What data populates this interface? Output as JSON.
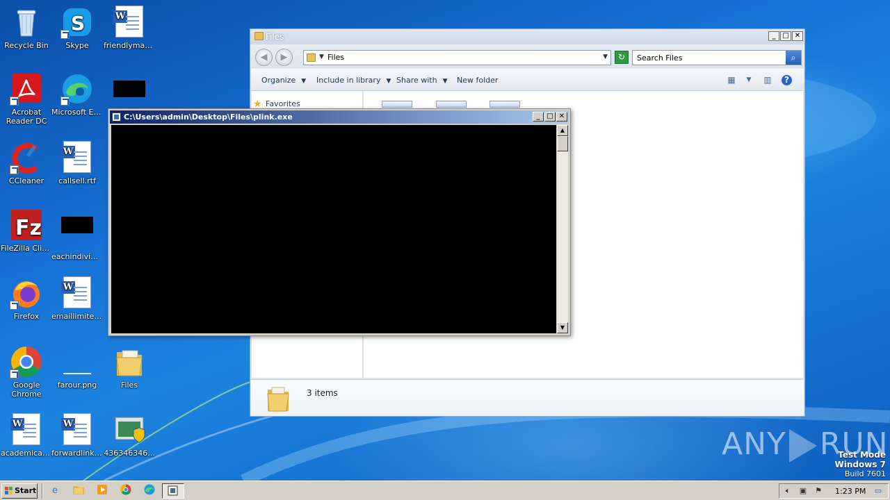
{
  "desktop_icons": [
    {
      "label": "Recycle Bin",
      "icon": "recycle-bin-icon"
    },
    {
      "label": "Skype",
      "icon": "skype-icon"
    },
    {
      "label": "friendlymay...",
      "icon": "word-doc-icon"
    },
    {
      "label": "Acrobat Reader DC",
      "icon": "acrobat-icon"
    },
    {
      "label": "Microsoft Edge",
      "icon": "edge-icon"
    },
    {
      "label": "CCleaner",
      "icon": "ccleaner-icon"
    },
    {
      "label": "callsell.rtf",
      "icon": "word-doc-icon"
    },
    {
      "label": "FileZilla Client",
      "icon": "filezilla-icon"
    },
    {
      "label": "eachindividu...",
      "icon": "black-thumbnail-icon"
    },
    {
      "label": "Firefox",
      "icon": "firefox-icon"
    },
    {
      "label": "emaillimited.rtf",
      "icon": "word-doc-icon"
    },
    {
      "label": "Google Chrome",
      "icon": "chrome-icon"
    },
    {
      "label": "farour.png",
      "icon": "image-file-icon"
    },
    {
      "label": "Files",
      "icon": "folder-icon"
    },
    {
      "label": "academicas...",
      "icon": "word-doc-icon"
    },
    {
      "label": "forwardlink.rtf",
      "icon": "word-doc-icon"
    },
    {
      "label": "436346346...",
      "icon": "exe-shield-icon"
    }
  ],
  "explorer": {
    "title": "Files",
    "address_path": "Files",
    "search_placeholder": "Search Files",
    "commands": {
      "organize": "Organize",
      "include_in_library": "Include in library",
      "share_with": "Share with",
      "new_folder": "New folder"
    },
    "nav_favorites": "Favorites",
    "status_count": "3 items"
  },
  "console": {
    "title": "C:\\Users\\admin\\Desktop\\Files\\plink.exe"
  },
  "taskbar": {
    "start_label": "Start",
    "clock": "1:23 PM"
  },
  "watermark": {
    "brand": "ANY RUN",
    "brand_left": "ANY",
    "brand_right": "RUN",
    "test_mode": "Test Mode",
    "os": "Windows 7",
    "build": "Build 7601"
  },
  "colors": {
    "desktop_blue": "#1771d6",
    "console_title_start": "#0a246a",
    "console_title_end": "#a6caf0",
    "taskbar": "#d4d0c8"
  }
}
